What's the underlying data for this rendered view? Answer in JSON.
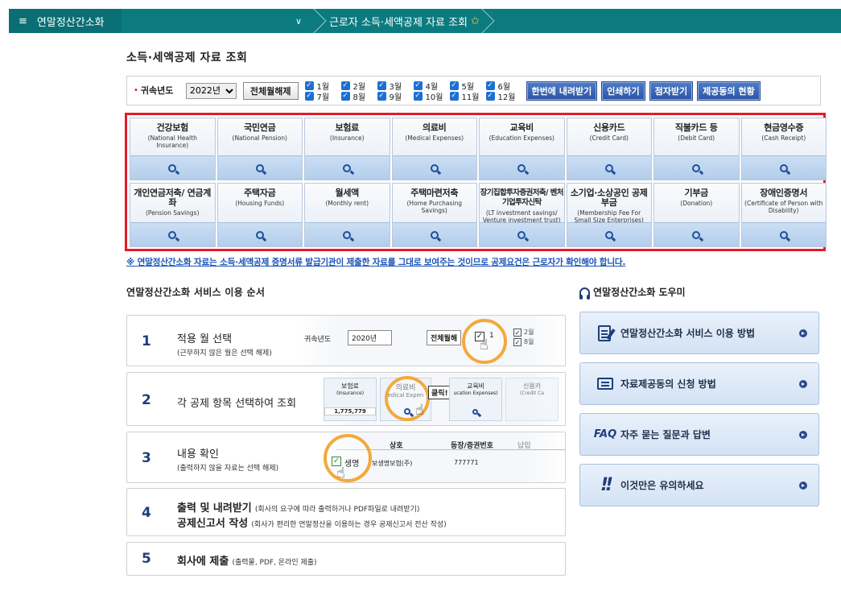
{
  "topbar": {
    "menu_label": "연말정산간소화",
    "crumb_label": "근로자 소득·세액공제 자료 조회"
  },
  "page_title": "소득·세액공제 자료 조회",
  "filter": {
    "year_label": "귀속년도",
    "year_value": "2022년",
    "deselect_all": "전체월해제",
    "months": [
      "1월",
      "2월",
      "3월",
      "4월",
      "5월",
      "6월",
      "7월",
      "8월",
      "9월",
      "10월",
      "11월",
      "12월"
    ],
    "buttons": [
      "한번에 내려받기",
      "인쇄하기",
      "점자받기",
      "제공동의 현황"
    ]
  },
  "categories": [
    {
      "ko": "건강보험",
      "en": "(National Health Insurance)"
    },
    {
      "ko": "국민연금",
      "en": "(National Pension)"
    },
    {
      "ko": "보험료",
      "en": "(Insurance)"
    },
    {
      "ko": "의료비",
      "en": "(Medical Expenses)"
    },
    {
      "ko": "교육비",
      "en": "(Education Expenses)"
    },
    {
      "ko": "신용카드",
      "en": "(Credit Card)"
    },
    {
      "ko": "직불카드 등",
      "en": "(Debit Card)"
    },
    {
      "ko": "현금영수증",
      "en": "(Cash Receipt)"
    },
    {
      "ko": "개인연금저축/ 연금계좌",
      "en": "(Pension Savings)"
    },
    {
      "ko": "주택자금",
      "en": "(Housing Funds)"
    },
    {
      "ko": "월세액",
      "en": "(Monthly rent)"
    },
    {
      "ko": "주택마련저축",
      "en": "(Home Purchasing Savings)"
    },
    {
      "ko": "장기집합투자증권저축/ 벤처기업투자신탁",
      "en": "(LT investment savings/ Venture investment trust)"
    },
    {
      "ko": "소기업·소상공인 공제부금",
      "en": "(Membership Fee For Small Size Enterprises)"
    },
    {
      "ko": "기부금",
      "en": "(Donation)"
    },
    {
      "ko": "장애인증명서",
      "en": "(Certificate of Person with Disability)"
    }
  ],
  "notice": "※ 연말정산간소화 자료는 소득·세액공제 증명서류 발급기관이 제출한 자료를 그대로 보여주는 것이므로 공제요건은 근로자가 확인해야 합니다.",
  "steps_title": "연말정산간소화 서비스 이용 순서",
  "steps": [
    {
      "num": "1",
      "title": "적용 월 선택",
      "sub": "(근무하지 않은 월은 선택 해제)"
    },
    {
      "num": "2",
      "title": "각 공제 항목 선택하여 조회",
      "sub": ""
    },
    {
      "num": "3",
      "title": "내용 확인",
      "sub": "(출력하지 않을 자료는 선택 해제)"
    },
    {
      "num": "4",
      "title": "출력 및 내려받기",
      "sub": "(회사의 요구에 따라 출력하거나 PDF파일로 내려받기)",
      "title2": "공제신고서 작성",
      "sub2": "(회사가 편리한 연말정산을 이용하는 경우 공제신고서 전산 작성)"
    },
    {
      "num": "5",
      "title": "회사에 제출",
      "sub": "(출력물, PDF, 온라인 제출)"
    }
  ],
  "step_illus": {
    "s1_year_label": "귀속년도",
    "s1_year": "2020년",
    "s1_btn": "전체월해",
    "s1_m1": "1",
    "s1_m2": "2월",
    "s1_m8": "8월",
    "s2_c1": "보험료",
    "s2_c1en": "(Insurance)",
    "s2_c1val": "1,775,779",
    "s2_c2": "의료비",
    "s2_c2en": "edical Expen",
    "s2_click": "클릭!",
    "s2_c3": "교육비",
    "s2_c3en": "ucation Expenses)",
    "s2_c4": "신용카",
    "s2_c4en": "(Credit Ca",
    "s3_h1": "상호",
    "s3_h2": "등장/증권번호",
    "s3_h3": "납입",
    "s3_row1a": "생명",
    "s3_row1b": "보생명보험(주)",
    "s3_row1c": "777771"
  },
  "helper_title": "연말정산간소화 도우미",
  "helpers": [
    {
      "label": "연말정산간소화 서비스 이용 방법"
    },
    {
      "label": "자료제공동의 신청 방법"
    },
    {
      "icon_text": "FAQ",
      "label": "자주 묻는 질문과 답변"
    },
    {
      "label": "이것만은 유의하세요"
    }
  ]
}
